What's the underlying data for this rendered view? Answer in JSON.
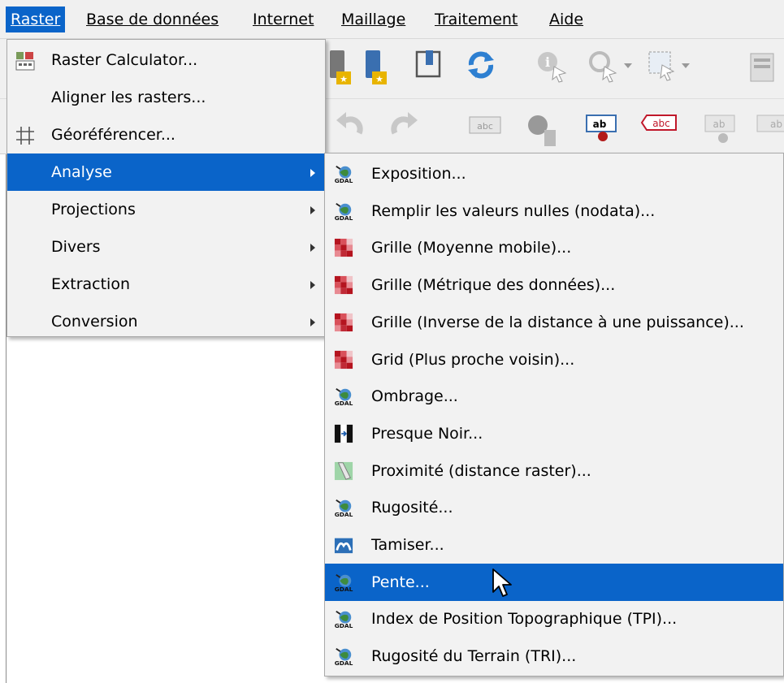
{
  "menubar": {
    "items": [
      {
        "label": "Raster",
        "active": true
      },
      {
        "label": "Base de données"
      },
      {
        "label": "Internet"
      },
      {
        "label": "Maillage"
      },
      {
        "label": "Traitement"
      },
      {
        "label": "Aide"
      }
    ]
  },
  "toolbar_icons": [
    "new-layer-star-icon",
    "new-layer-star-blue-icon",
    "bookmark-icon",
    "refresh-icon",
    "identify-icon",
    "zoom-select-icon",
    "select-rectangle-icon",
    "attributes-icon",
    "undo-icon",
    "redo-icon",
    "label-abc-icon",
    "label-pin-icon",
    "label-ab-move-icon",
    "label-abc-red-icon",
    "label-ab-gray-icon"
  ],
  "raster_menu": {
    "items": [
      {
        "label": "Raster Calculator...",
        "icon": "raster-calculator-icon"
      },
      {
        "label": "Aligner les rasters..."
      },
      {
        "label": "Géoréférencer...",
        "icon": "georeferencer-grid-icon"
      },
      {
        "label": "Analyse",
        "submenu": true,
        "selected": true
      },
      {
        "label": "Projections",
        "submenu": true
      },
      {
        "label": "Divers",
        "submenu": true
      },
      {
        "label": "Extraction",
        "submenu": true
      },
      {
        "label": "Conversion",
        "submenu": true
      }
    ]
  },
  "analyse_submenu": {
    "items": [
      {
        "label": "Exposition...",
        "icon": "gdal-icon"
      },
      {
        "label": "Remplir les valeurs nulles (nodata)...",
        "icon": "gdal-icon"
      },
      {
        "label": "Grille (Moyenne mobile)...",
        "icon": "grid-red-icon"
      },
      {
        "label": "Grille (Métrique des données)...",
        "icon": "grid-red-icon"
      },
      {
        "label": "Grille (Inverse de la distance à une puissance)...",
        "icon": "grid-red-icon"
      },
      {
        "label": "Grid (Plus proche voisin)...",
        "icon": "grid-red-icon"
      },
      {
        "label": "Ombrage...",
        "icon": "gdal-icon"
      },
      {
        "label": "Presque Noir...",
        "icon": "nearblack-icon"
      },
      {
        "label": "Proximité (distance raster)...",
        "icon": "proximity-icon"
      },
      {
        "label": "Rugosité...",
        "icon": "gdal-icon"
      },
      {
        "label": "Tamiser...",
        "icon": "sieve-icon"
      },
      {
        "label": "Pente...",
        "icon": "gdal-icon",
        "selected": true
      },
      {
        "label": "Index de Position Topographique (TPI)...",
        "icon": "gdal-icon"
      },
      {
        "label": "Rugosité du Terrain (TRI)...",
        "icon": "gdal-icon"
      }
    ]
  },
  "colors": {
    "selection": "#0a64c9",
    "menu_bg": "#f2f2f2",
    "toolbar_bg": "#f0f0f0"
  }
}
